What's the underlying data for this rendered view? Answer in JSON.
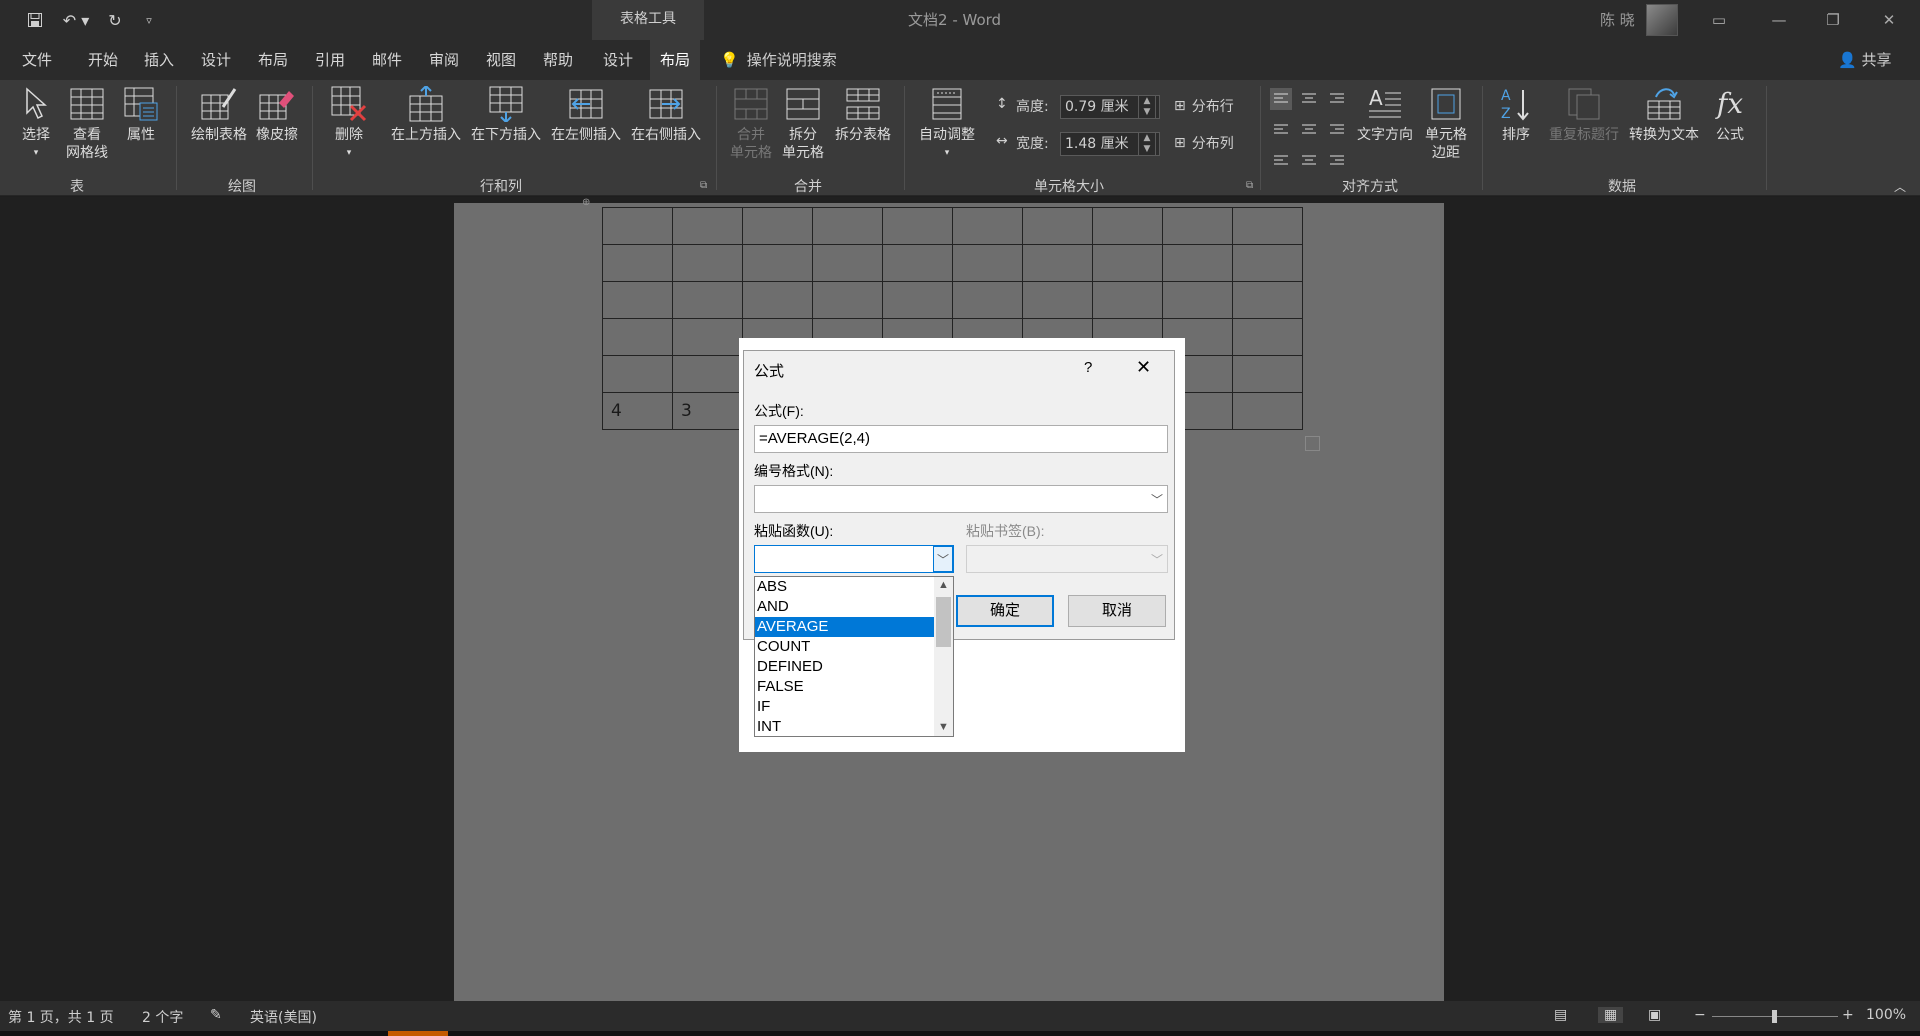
{
  "app": {
    "doc_title": "文档2",
    "app_name": "Word",
    "title_sep": " - ",
    "user": "陈 晓"
  },
  "context_group": "表格工具",
  "tabs": [
    "文件",
    "开始",
    "插入",
    "设计",
    "布局",
    "引用",
    "邮件",
    "审阅",
    "视图",
    "帮助",
    "设计",
    "布局"
  ],
  "active_tab_index": 11,
  "search_label": "操作说明搜索",
  "share_label": "共享",
  "ribbon": {
    "groups": {
      "table": "表",
      "draw": "绘图",
      "rows_cols": "行和列",
      "merge": "合并",
      "cell_size": "单元格大小",
      "align": "对齐方式",
      "data": "数据"
    },
    "buttons": {
      "select": "选择",
      "gridlines_1": "查看",
      "gridlines_2": "网格线",
      "properties": "属性",
      "draw_table": "绘制表格",
      "eraser": "橡皮擦",
      "delete": "删除",
      "insert_above": "在上方插入",
      "insert_below": "在下方插入",
      "insert_left": "在左侧插入",
      "insert_right": "在右侧插入",
      "merge_1": "合并",
      "merge_2": "单元格",
      "split_1": "拆分",
      "split_2": "单元格",
      "split_table": "拆分表格",
      "autofit": "自动调整",
      "dist_rows": "分布行",
      "dist_cols": "分布列",
      "text_dir": "文字方向",
      "margins_1": "单元格",
      "margins_2": "边距",
      "sort": "排序",
      "repeat_header": "重复标题行",
      "to_text": "转换为文本",
      "formula": "公式"
    },
    "height_label": "高度:",
    "height_value": "0.79 厘米",
    "width_label": "宽度:",
    "width_value": "1.48 厘米"
  },
  "table": {
    "rows": [
      [
        "",
        "",
        "",
        "",
        "",
        "",
        "",
        "",
        "",
        ""
      ],
      [
        "",
        "",
        "",
        "",
        "",
        "",
        "",
        "",
        "",
        ""
      ],
      [
        "",
        "",
        "",
        "",
        "",
        "",
        "",
        "",
        "",
        ""
      ],
      [
        "",
        "",
        "",
        "",
        "",
        "",
        "",
        "",
        "",
        ""
      ],
      [
        "",
        "",
        "",
        "",
        "",
        "",
        "",
        "",
        "",
        ""
      ],
      [
        "4",
        "3",
        "",
        "",
        "",
        "",
        "",
        "",
        "",
        ""
      ]
    ]
  },
  "dialog": {
    "title": "公式",
    "help": "?",
    "close": "✕",
    "formula_label": "公式(F):",
    "formula_value": "=AVERAGE(2,4)",
    "numfmt_label": "编号格式(N):",
    "numfmt_value": "",
    "paste_func_label": "粘贴函数(U):",
    "paste_bookmark_label": "粘贴书签(B):",
    "ok": "确定",
    "cancel": "取消",
    "functions": [
      "ABS",
      "AND",
      "AVERAGE",
      "COUNT",
      "DEFINED",
      "FALSE",
      "IF",
      "INT"
    ],
    "selected_function": "AVERAGE"
  },
  "status": {
    "page": "第 1 页，共 1 页",
    "words": "2 个字",
    "lang": "英语(美国)",
    "zoom": "100%"
  }
}
